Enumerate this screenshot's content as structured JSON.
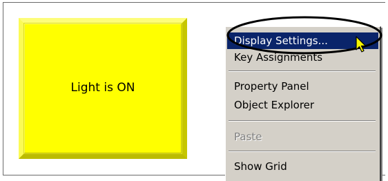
{
  "canvas": {
    "light_panel": {
      "label": "Light is ON",
      "color": "#ffff00"
    }
  },
  "context_menu": {
    "items": [
      {
        "label": "Display Settings...",
        "state": "highlighted"
      },
      {
        "label": "Key Assignments",
        "state": "normal"
      },
      {
        "label": "Property Panel",
        "state": "normal"
      },
      {
        "label": "Object Explorer",
        "state": "normal"
      },
      {
        "label": "Paste",
        "state": "disabled"
      },
      {
        "label": "Show Grid",
        "state": "normal"
      }
    ],
    "highlight_color": "#0a246a"
  },
  "annotation": {
    "icon": "ellipse-callout",
    "cursor": "arrow-cursor-icon"
  }
}
